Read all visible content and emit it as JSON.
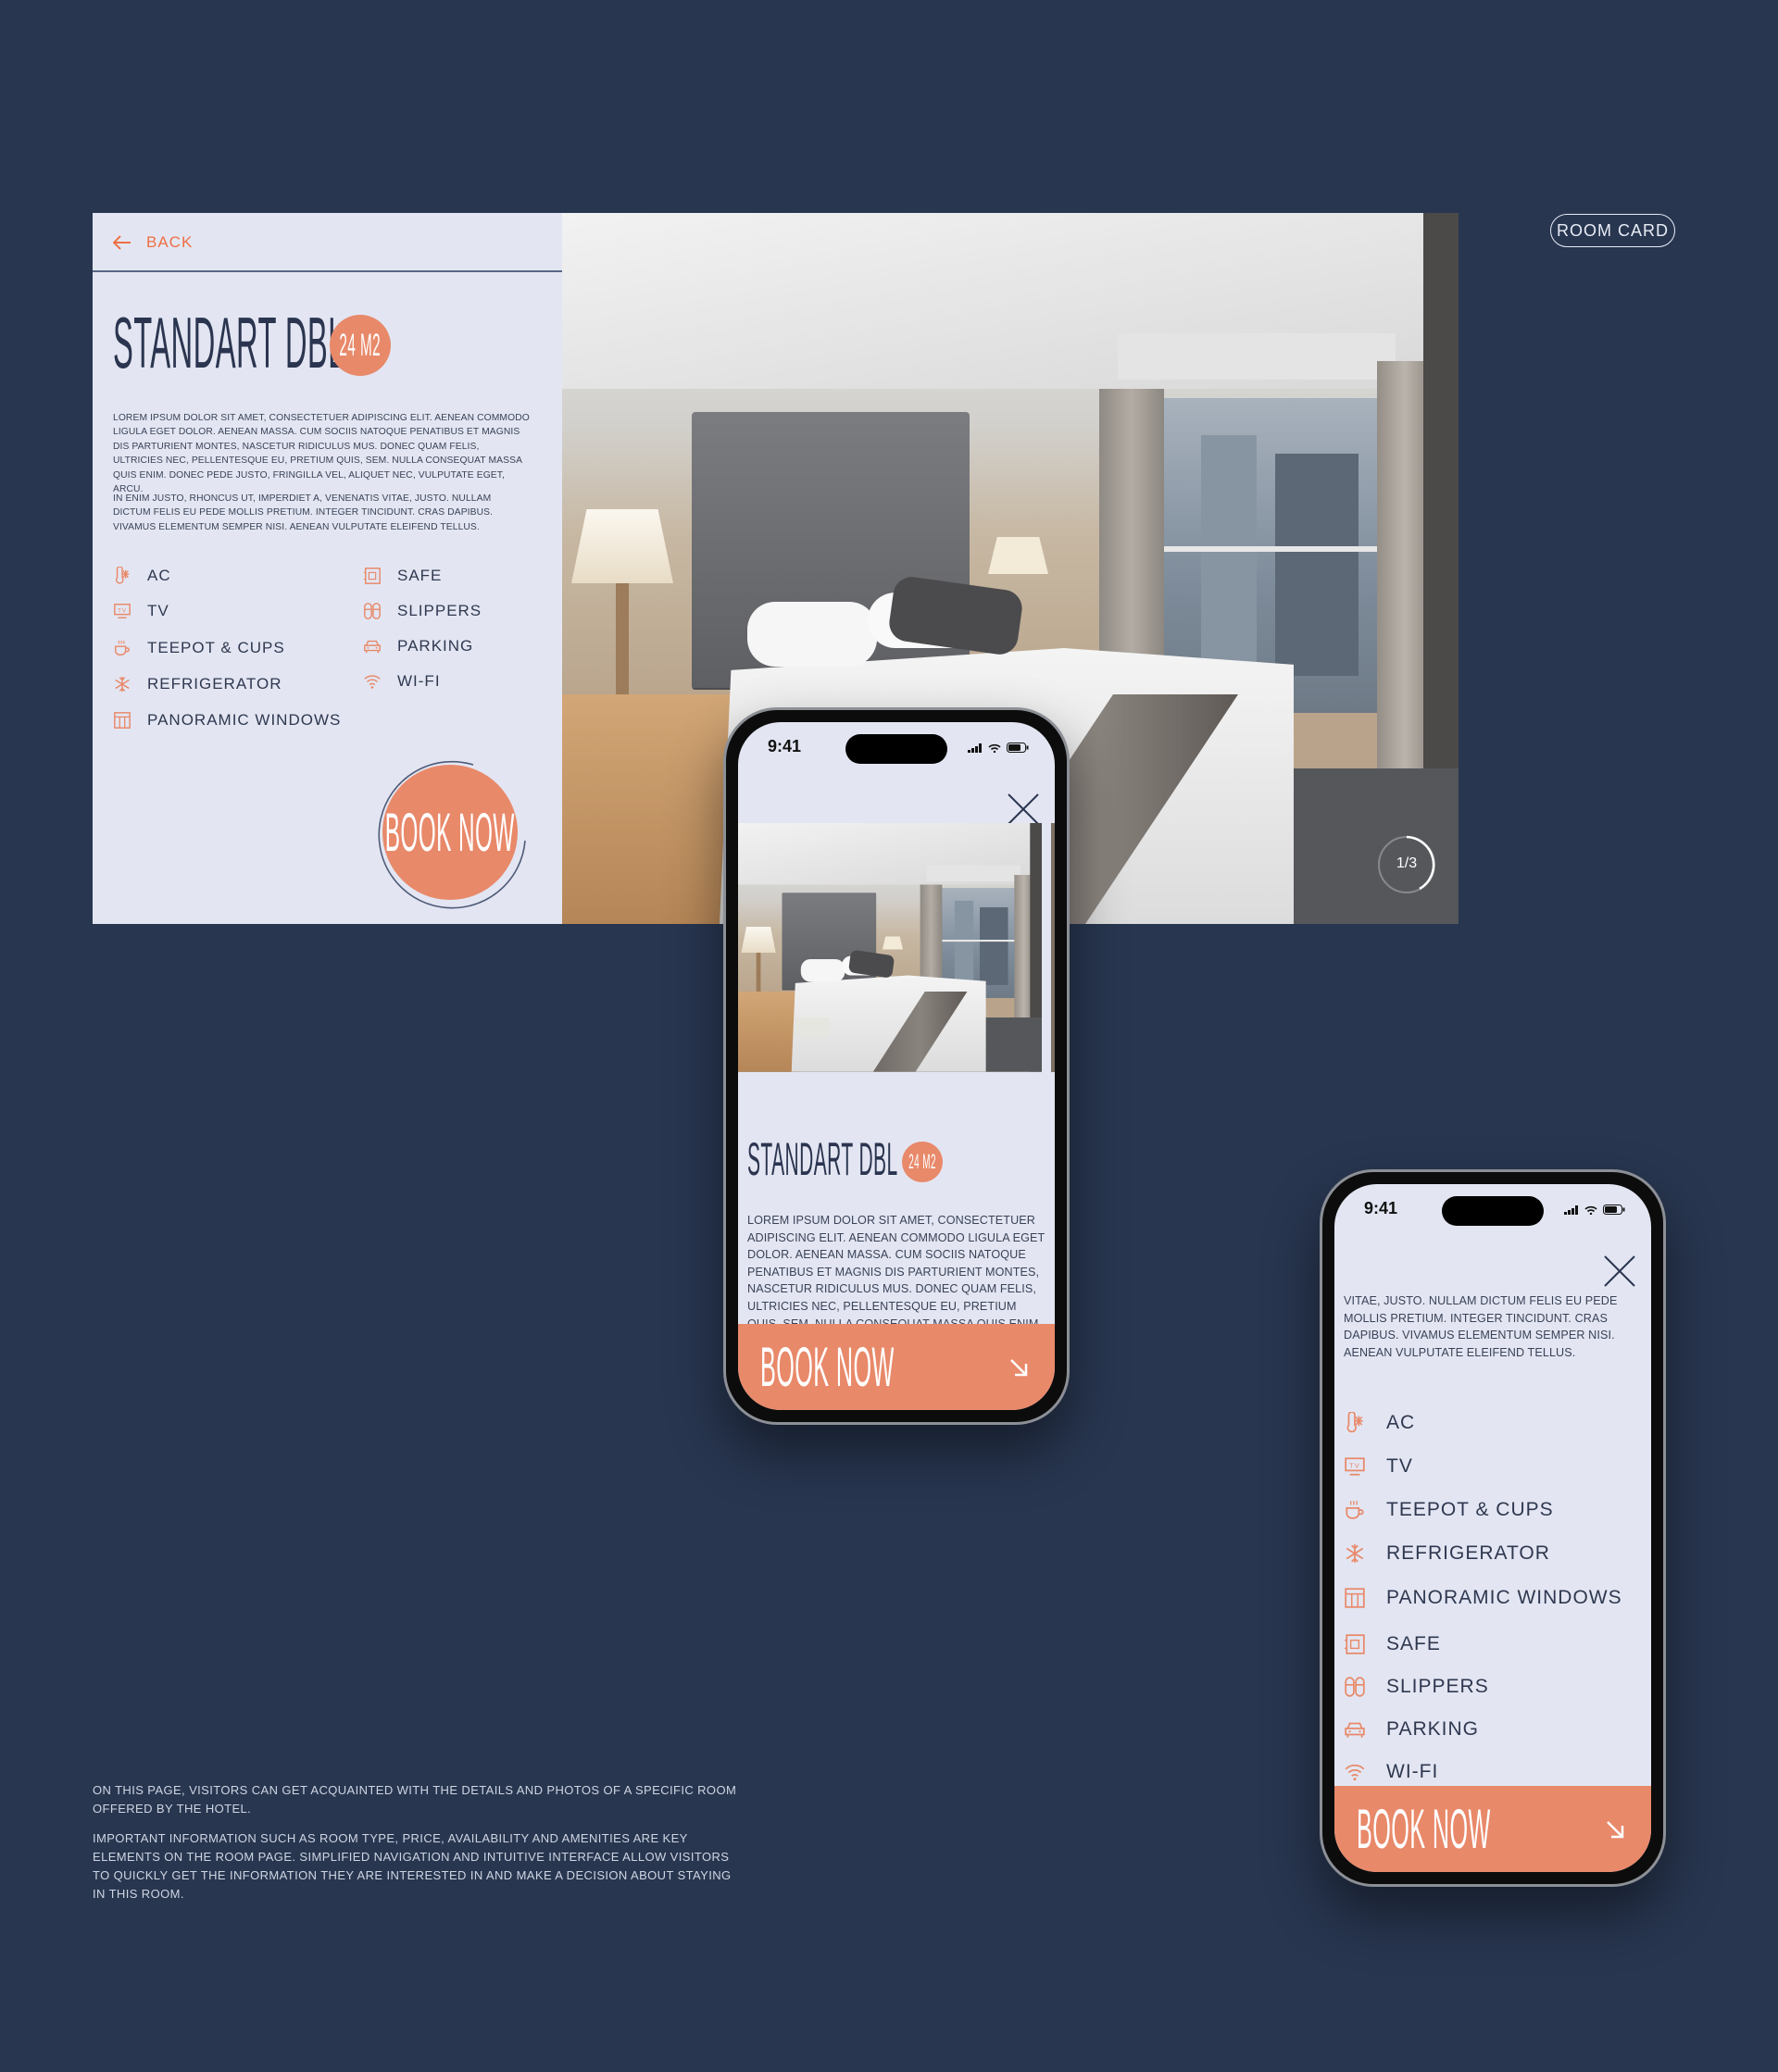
{
  "tag": "ROOM CARD",
  "colors": {
    "background": "#283650",
    "panel": "#e3e6f2",
    "accent": "#e8896a",
    "text": "#2b3550"
  },
  "desktop": {
    "back_label": "BACK",
    "room_title": "STANDART DBL",
    "area_badge": "24 M2",
    "description": [
      "LOREM IPSUM DOLOR SIT AMET, CONSECTETUER ADIPISCING ELIT. AENEAN COMMODO LIGULA EGET DOLOR. AENEAN MASSA. CUM SOCIIS NATOQUE PENATIBUS ET MAGNIS DIS PARTURIENT MONTES, NASCETUR RIDICULUS MUS. DONEC QUAM FELIS, ULTRICIES NEC, PELLENTESQUE EU, PRETIUM QUIS, SEM. NULLA CONSEQUAT MASSA QUIS ENIM. DONEC PEDE JUSTO, FRINGILLA VEL, ALIQUET NEC, VULPUTATE EGET, ARCU.",
      "IN ENIM JUSTO, RHONCUS UT, IMPERDIET A, VENENATIS VITAE, JUSTO. NULLAM DICTUM FELIS EU PEDE MOLLIS PRETIUM. INTEGER TINCIDUNT. CRAS DAPIBUS. VIVAMUS ELEMENTUM SEMPER NISI. AENEAN VULPUTATE ELEIFEND TELLUS."
    ],
    "book_label": "BOOK NOW",
    "photo_counter": "1/3",
    "photo_progress": 0.33
  },
  "amenities": [
    {
      "label": "AC",
      "icon": "ac"
    },
    {
      "label": "TV",
      "icon": "tv"
    },
    {
      "label": "TEEPOT & CUPS",
      "icon": "cup"
    },
    {
      "label": "REFRIGERATOR",
      "icon": "snowflake"
    },
    {
      "label": "PANORAMIC WINDOWS",
      "icon": "window"
    },
    {
      "label": "SAFE",
      "icon": "safe"
    },
    {
      "label": "SLIPPERS",
      "icon": "slippers"
    },
    {
      "label": "PARKING",
      "icon": "car"
    },
    {
      "label": "WI-FI",
      "icon": "wifi"
    }
  ],
  "mobile1": {
    "time": "9:41",
    "room_title": "STANDART DBL",
    "area_badge": "24 M2",
    "description": "LOREM IPSUM DOLOR SIT AMET, CONSECTETUER ADIPISCING ELIT. AENEAN COMMODO LIGULA EGET DOLOR. AENEAN MASSA. CUM SOCIIS NATOQUE PENATIBUS ET MAGNIS DIS PARTURIENT MONTES, NASCETUR RIDICULUS MUS. DONEC QUAM FELIS, ULTRICIES NEC, PELLENTESQUE EU, PRETIUM QUIS, SEM. NULLA CONSEQUAT MASSA QUIS ENIM. DONEC",
    "book_label": "BOOK NOW"
  },
  "mobile2": {
    "time": "9:41",
    "description": "VITAE, JUSTO. NULLAM DICTUM FELIS EU PEDE MOLLIS PRETIUM. INTEGER TINCIDUNT. CRAS DAPIBUS. VIVAMUS ELEMENTUM SEMPER NISI. AENEAN VULPUTATE ELEIFEND TELLUS.",
    "book_label": "BOOK NOW"
  },
  "footer": [
    "ON THIS PAGE, VISITORS CAN GET ACQUAINTED WITH THE DETAILS AND PHOTOS OF A SPECIFIC ROOM OFFERED BY THE HOTEL.",
    "IMPORTANT INFORMATION SUCH AS ROOM TYPE, PRICE, AVAILABILITY AND AMENITIES ARE KEY ELEMENTS ON THE ROOM PAGE. SIMPLIFIED NAVIGATION AND INTUITIVE INTERFACE ALLOW VISITORS TO QUICKLY GET THE INFORMATION THEY ARE INTERESTED IN AND MAKE A DECISION ABOUT STAYING IN THIS ROOM."
  ]
}
